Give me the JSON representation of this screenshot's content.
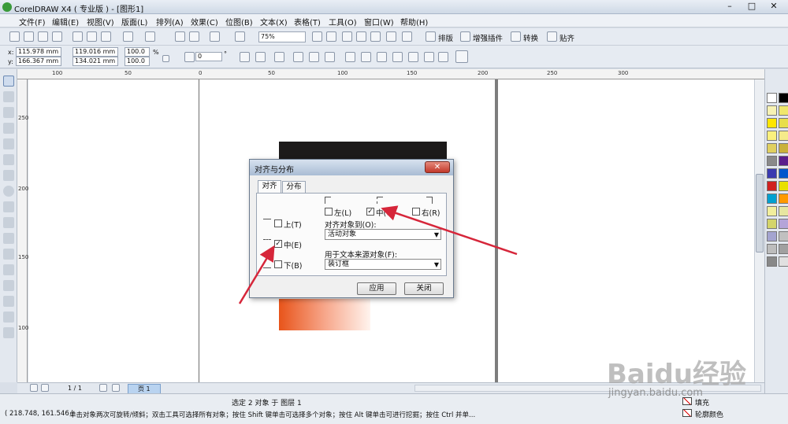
{
  "window": {
    "title": "CorelDRAW X4 ( 专业版 ) - [图形1]",
    "minimize": "–",
    "maximize": "□",
    "close": "✕"
  },
  "menu": [
    "文件(F)",
    "编辑(E)",
    "视图(V)",
    "版面(L)",
    "排列(A)",
    "效果(C)",
    "位图(B)",
    "文本(X)",
    "表格(T)",
    "工具(O)",
    "窗口(W)",
    "帮助(H)"
  ],
  "toolbar": {
    "zoom": "75%",
    "plugin_labels": [
      "排版",
      "增强插件",
      "转换",
      "贴齐"
    ]
  },
  "property_bar": {
    "x_label": "x:",
    "x": "115.978 mm",
    "y_label": "y:",
    "y": "166.367 mm",
    "w": "119.016 mm",
    "h": "134.021 mm",
    "scale_w": "100.0",
    "scale_h": "100.0",
    "percent": "%",
    "rotation": "0",
    "degree": "°"
  },
  "ruler_top": [
    "100",
    "50",
    "0",
    "50",
    "100",
    "150",
    "200",
    "250",
    "300"
  ],
  "ruler_left": [
    "250",
    "200",
    "150",
    "100"
  ],
  "dialog": {
    "title": "对齐与分布",
    "close": "✕",
    "tabs": [
      "对齐",
      "分布"
    ],
    "horizontal": {
      "left_label": "左(L)",
      "left_checked": false,
      "center_label": "中(C)",
      "center_checked": true,
      "right_label": "右(R)",
      "right_checked": false
    },
    "vertical": {
      "top_label": "上(T)",
      "top_checked": false,
      "middle_label": "中(E)",
      "middle_checked": true,
      "bottom_label": "下(B)",
      "bottom_checked": false
    },
    "align_to_label": "对齐对象到(O):",
    "align_to_value": "活动对象",
    "text_source_label": "用于文本来源对象(F):",
    "text_source_value": "装订框",
    "apply": "应用",
    "close_button": "关闭",
    "check_mark": "✓"
  },
  "page_nav": {
    "counter": "1 / 1",
    "page_tab": "页 1"
  },
  "status": {
    "selection": "选定 2 对象 于 图层 1",
    "coords": "( 218.748, 161.546 )",
    "hint": "单击对象两次可旋转/倾斜；双击工具可选择所有对象；按住 Shift 键单击可选择多个对象；按住 Alt 键单击可进行挖掘；按住 Ctrl 并单...",
    "fill_label": "填充",
    "outline_label": "轮廓颜色"
  },
  "watermark": {
    "brand": "Baidu经验",
    "url": "jingyan.baidu.com"
  },
  "palette_colors": [
    "#ffffff",
    "#000000",
    "#f7f2b3",
    "#f0e76c",
    "#ffe600",
    "#e8de4a",
    "#fbf07e",
    "#f5ea8a",
    "#e0d060",
    "#c9b13a",
    "#8a8a8a",
    "#5a1e8c",
    "#3a3ab0",
    "#0055cc",
    "#d02020",
    "#e8e000",
    "#00a0d0",
    "#ff9900",
    "#f2ee9c",
    "#e6e6a0",
    "#d4d46a",
    "#b4a4d8",
    "#a4a4d0",
    "#c0c0c0",
    "#bdbdbd",
    "#a0a0a0",
    "#888888",
    "#e0e0e0"
  ],
  "accent": {
    "arrow": "#d6263a",
    "dialog_close": "#c2382a"
  }
}
